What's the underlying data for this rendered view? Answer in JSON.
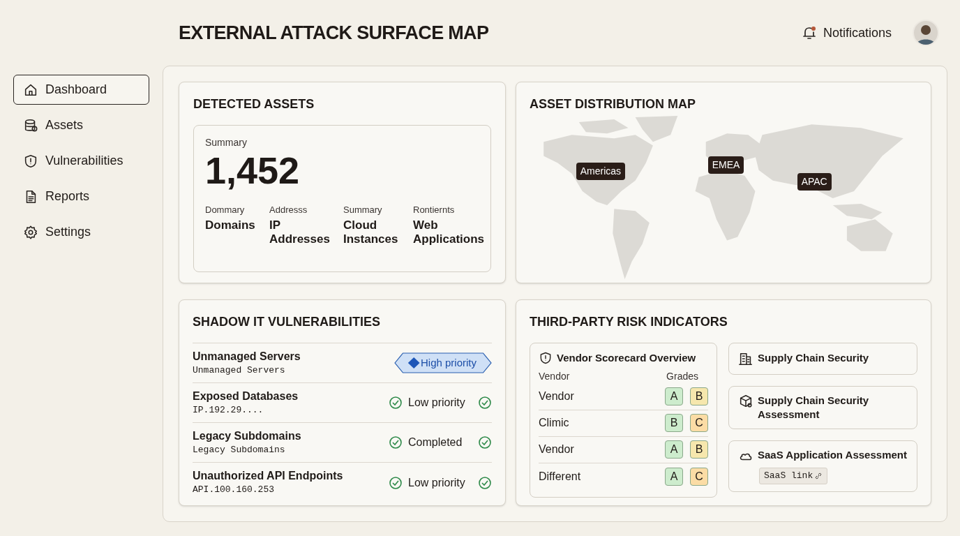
{
  "header": {
    "title": "EXTERNAL ATTACK SURFACE MAP",
    "notifications": {
      "label": "Notifications",
      "unread": true
    }
  },
  "sidebar": {
    "items": [
      {
        "label": "Dashboard",
        "selected": true
      },
      {
        "label": "Assets",
        "selected": false
      },
      {
        "label": "Vulnerabilities",
        "selected": false
      },
      {
        "label": "Reports",
        "selected": false
      },
      {
        "label": "Settings",
        "selected": false
      }
    ]
  },
  "detected_assets": {
    "title": "DETECTED ASSETS",
    "summary_label": "Summary",
    "total": "1,452",
    "categories": [
      {
        "caption": "Dommary",
        "name": "Domains"
      },
      {
        "caption": "Addresss",
        "name": "IP Addresses"
      },
      {
        "caption": "Summary",
        "name": "Cloud Instances"
      },
      {
        "caption": "Rontiernts",
        "name": "Web Applications"
      }
    ]
  },
  "map": {
    "title": "ASSET DISTRIBUTION MAP",
    "regions": [
      "Americas",
      "EMEA",
      "APAC"
    ]
  },
  "shadow_it": {
    "title": "SHADOW IT VULNERABILITIES",
    "rows": [
      {
        "name": "Unmanaged Servers",
        "detail": "Unmanaged Servers",
        "status": "High priority",
        "kind": "high"
      },
      {
        "name": "Exposed Databases",
        "detail": "IP.192.29....",
        "status": "Low priority",
        "kind": "ok"
      },
      {
        "name": "Legacy Subdomains",
        "detail": "Legacy Subdomains",
        "status": "Completed",
        "kind": "ok"
      },
      {
        "name": "Unauthorized API Endpoints",
        "detail": "API.100.160.253",
        "status": "Low priority",
        "kind": "ok"
      }
    ]
  },
  "third_party": {
    "title": "THIRD-PARTY RISK INDICATORS",
    "scorecard": {
      "title": "Vendor Scorecard Overview",
      "column_1": "Vendor",
      "column_2": "Grades",
      "rows": [
        {
          "vendor": "Vendor",
          "grades": [
            {
              "grade": "A",
              "color": "#cdeccd"
            },
            {
              "grade": "B",
              "color": "#f6e7ad"
            }
          ]
        },
        {
          "vendor": "Climic",
          "grades": [
            {
              "grade": "B",
              "color": "#cdeccd"
            },
            {
              "grade": "C",
              "color": "#fbdca5"
            }
          ]
        },
        {
          "vendor": "Vendor",
          "grades": [
            {
              "grade": "A",
              "color": "#cdeccd"
            },
            {
              "grade": "B",
              "color": "#f6e7ad"
            }
          ]
        },
        {
          "vendor": "Different",
          "grades": [
            {
              "grade": "A",
              "color": "#cdeccd"
            },
            {
              "grade": "C",
              "color": "#fbdca5"
            }
          ]
        }
      ]
    },
    "cards": [
      {
        "title": "Supply Chain Security"
      },
      {
        "title": "Supply Chain Security Assessment"
      },
      {
        "title": "SaaS Application Assessment",
        "link": "SaaS link"
      }
    ]
  }
}
